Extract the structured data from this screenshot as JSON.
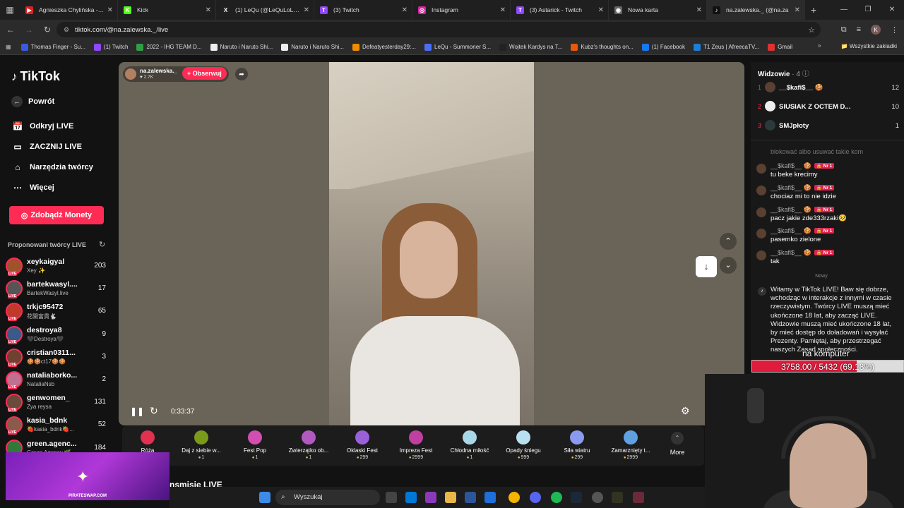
{
  "browser": {
    "tabs": [
      {
        "title": "Agnieszka Chylińska - Kró",
        "color": "#e02020",
        "letter": "▶"
      },
      {
        "title": "Kick",
        "color": "#53fc18",
        "letter": "K"
      },
      {
        "title": "(1) LeQu (@LeQuLoL) / X",
        "color": "#222",
        "letter": "X"
      },
      {
        "title": "(3) Twitch",
        "color": "#9146ff",
        "letter": "T"
      },
      {
        "title": "Instagram",
        "color": "#d6249f",
        "letter": "◎"
      },
      {
        "title": "(3) Astarick - Twitch",
        "color": "#9146ff",
        "letter": "T"
      },
      {
        "title": "Nowa karta",
        "color": "#666",
        "letter": "◉"
      },
      {
        "title": "na.zalewska._ (@na.za",
        "color": "#111",
        "letter": "♪",
        "active": true
      }
    ],
    "url": "tiktok.com/@na.zalewska._/live",
    "profile_letter": "K",
    "bookmarks": [
      {
        "label": "Thomas Finger - Su...",
        "color": "#3b5bdb"
      },
      {
        "label": "(1) Twitch",
        "color": "#9146ff"
      },
      {
        "label": "2022 - IHG TEAM D...",
        "color": "#2f9e44"
      },
      {
        "label": "Naruto i Naruto Shi...",
        "color": "#eee"
      },
      {
        "label": "Naruto i Naruto Shi...",
        "color": "#eee"
      },
      {
        "label": "Defeatyesterday29:...",
        "color": "#f08c00"
      },
      {
        "label": "LeQu - Summoner S...",
        "color": "#4c6ef5"
      },
      {
        "label": "Wojtek Kardys na T...",
        "color": "#222"
      },
      {
        "label": "Kubz's thoughts on...",
        "color": "#e8590c"
      },
      {
        "label": "(1) Facebook",
        "color": "#1877f2"
      },
      {
        "label": "T1 Zeus | AfreecaTV...",
        "color": "#1c7ed6"
      },
      {
        "label": "Gmail",
        "color": "#e03131"
      }
    ],
    "all_bookmarks": "Wszystkie zakładki"
  },
  "sidebar": {
    "logo": "TikTok",
    "back": "Powrót",
    "nav": [
      {
        "label": "Odkryj LIVE",
        "icon": "📅"
      },
      {
        "label": "ZACZNIJ LIVE",
        "icon": "▭"
      },
      {
        "label": "Narzędzia twórcy",
        "icon": "⌂"
      },
      {
        "label": "Więcej",
        "icon": "⋯"
      }
    ],
    "coins_button": "Zdobądź Monety",
    "suggested_title": "Proponowani twórcy LIVE",
    "creators": [
      {
        "name": "xeykaigyal",
        "sub": "Xey ✨",
        "count": "203",
        "color": "#a0522d"
      },
      {
        "name": "bartekwasyl....",
        "sub": "BartekWasyl.live",
        "count": "17",
        "color": "#555"
      },
      {
        "name": "trkjc95472",
        "sub": "花開富貴🐇",
        "count": "65",
        "color": "#c0392b"
      },
      {
        "name": "destroya8",
        "sub": "🖤Destroya🖤",
        "count": "9",
        "color": "#3a5a8a"
      },
      {
        "name": "cristian0311...",
        "sub": "🍪🍪ct17🍪🍪",
        "count": "3",
        "color": "#704030"
      },
      {
        "name": "nataliaborko...",
        "sub": "NataliaNsb",
        "count": "2",
        "color": "#c07090"
      },
      {
        "name": "genwomen_",
        "sub": "Zya reysa",
        "count": "131",
        "color": "#6a4a3a"
      },
      {
        "name": "kasia_bdnk",
        "sub": "🍓kasia_bdnk🍓...",
        "count": "52",
        "color": "#8a5a4a"
      },
      {
        "name": "green.agenc...",
        "sub": "Green Agency 🌿",
        "count": "184",
        "color": "#2f7a3a"
      }
    ]
  },
  "stream": {
    "streamer": "na.zalewska._",
    "likes": "♥ 2.7K",
    "follow": "+ Obserwuj",
    "elapsed": "0:33:37"
  },
  "gifts": [
    {
      "name": "Róża",
      "price": "1",
      "color": "#e03151"
    },
    {
      "name": "Daj z siebie w...",
      "price": "1",
      "color": "#7a9a1a"
    },
    {
      "name": "Fest Pop",
      "price": "1",
      "color": "#d04fb0"
    },
    {
      "name": "Zwierzątko ob...",
      "price": "1",
      "color": "#b05ac0"
    },
    {
      "name": "Oklaski Fest",
      "price": "299",
      "color": "#9a60d8"
    },
    {
      "name": "Impreza Fest",
      "price": "2999",
      "color": "#c040a0"
    },
    {
      "name": "Chłodna miłość",
      "price": "1",
      "color": "#a8d8e8"
    },
    {
      "name": "Opady śniegu",
      "price": "999",
      "color": "#b8e0f0"
    },
    {
      "name": "Siła wiatru",
      "price": "299",
      "color": "#8a9af0"
    },
    {
      "name": "Zamarznięty t...",
      "price": "2999",
      "color": "#60a0e0"
    }
  ],
  "more_label": "More",
  "bottom_section": "nsmisie LIVE",
  "panel": {
    "viewers_title": "Widzowie",
    "viewers_count": "· 4",
    "viewers": [
      {
        "rank": "1",
        "name": "__$kafi$__ 🍪",
        "score": "12",
        "color": "#5a4030"
      },
      {
        "rank": "2",
        "name": "SIUSIAK Z OCTEM D...",
        "score": "10",
        "color": "#eee"
      },
      {
        "rank": "3",
        "name": "SMJpłoty",
        "score": "1",
        "color": "#2a3a3a"
      }
    ],
    "faded": "blokować albo usuwać takie kom",
    "badge": "🔒 Nr 1",
    "messages": [
      {
        "user": "__$kafi$__ 🍪",
        "text": "tu beke krecimy"
      },
      {
        "user": "__$kafi$__ 🍪",
        "text": "chociaz mi to nie idzie"
      },
      {
        "user": "__$kafi$__ 🍪",
        "text": "pacz jakie zde333rzaki🥺"
      },
      {
        "user": "__$kafi$__ 🍪",
        "text": "pasemko zielone"
      },
      {
        "user": "__$kafi$__ 🍪",
        "text": "tak"
      }
    ],
    "new_sep": "Nowy",
    "welcome": "Witamy w TikTok LIVE! Baw się dobrze, wchodząc w interakcje z innymi w czasie rzeczywistym. Twórcy LIVE muszą mieć ukończone 18 lat, aby zacząć LIVE. Widzowie muszą mieć ukończone 18 lat, by mieć dostęp do doładowań i wysyłać Prezenty. Pamiętaj, aby przestrzegać naszych Zasad społeczności."
  },
  "overlay": {
    "label": "na komputer",
    "progress_text": "3758.00 / 5432 (69.18%)",
    "progress_fraction": 0.6918,
    "ad_text": "PIRATESWAP.COM"
  },
  "taskbar": {
    "search": "Wyszukaj"
  }
}
